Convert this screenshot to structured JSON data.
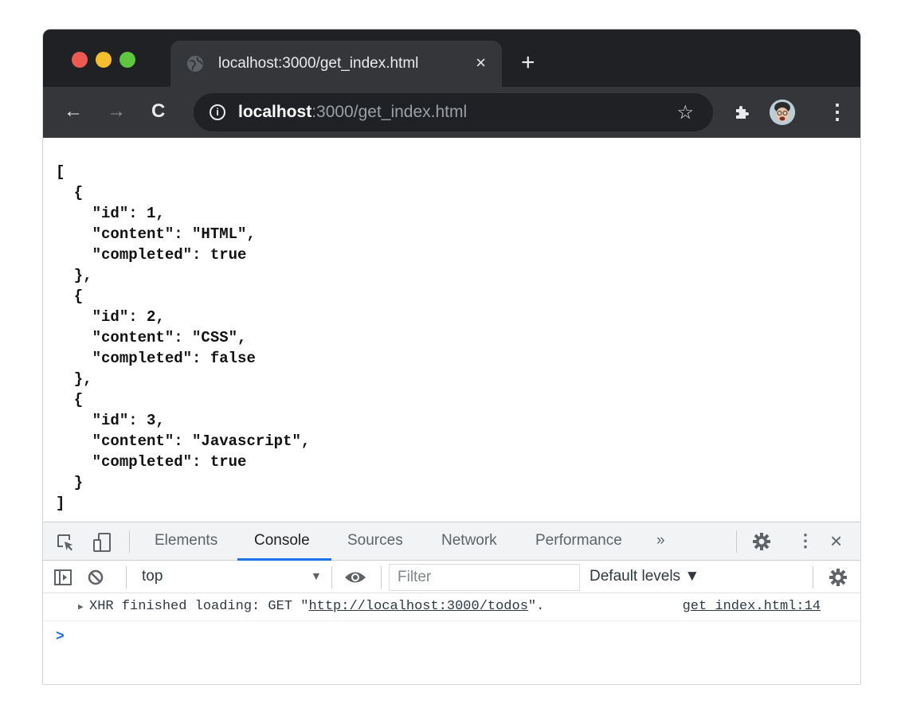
{
  "browser": {
    "tab": {
      "title": "localhost:3000/get_index.html",
      "close_icon": "×"
    },
    "new_tab_label": "+",
    "address": {
      "host": "localhost",
      "rest": ":3000/get_index.html"
    },
    "icons": {
      "back": "←",
      "forward": "→",
      "reload": "C",
      "info": "i",
      "star": "☆",
      "menu": "⋮"
    }
  },
  "page": {
    "json_lines": [
      "[",
      "  {",
      "    \"id\": 1,",
      "    \"content\": \"HTML\",",
      "    \"completed\": true",
      "  },",
      "  {",
      "    \"id\": 2,",
      "    \"content\": \"CSS\",",
      "    \"completed\": false",
      "  },",
      "  {",
      "    \"id\": 3,",
      "    \"content\": \"Javascript\",",
      "    \"completed\": true",
      "  }",
      "]"
    ]
  },
  "devtools": {
    "tabs": [
      "Elements",
      "Console",
      "Sources",
      "Network",
      "Performance"
    ],
    "active_tab": "Console",
    "more_tabs": "»",
    "close": "×",
    "context": "top",
    "filter_placeholder": "Filter",
    "levels": "Default levels ▼",
    "log": {
      "prefix": "XHR finished loading: GET \"",
      "url": "http://localhost:3000/todos",
      "suffix": "\".",
      "source": "get_index.html:14"
    },
    "prompt": ">"
  },
  "colors": {
    "tabstrip": "#202124",
    "toolbar": "#35363a",
    "accent": "#1a73e8"
  }
}
